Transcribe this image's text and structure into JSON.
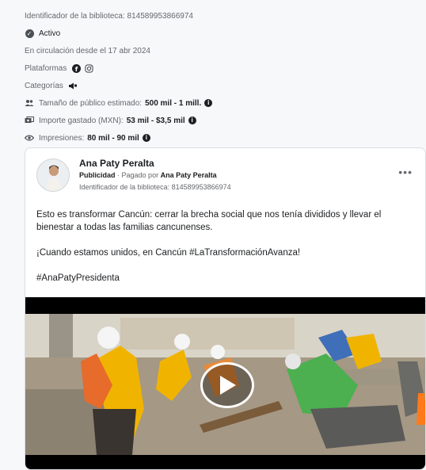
{
  "meta": {
    "library_id": "Identificador de la biblioteca: 814589953866974",
    "status": "Activo",
    "running_since": "En circulación desde el 17 abr 2024",
    "platforms_label": "Plataformas",
    "categories_label": "Categorías",
    "audience_label": "Tamaño de público estimado:",
    "audience_value": "500 mil - 1 mill.",
    "spent_label": "Importe gastado (MXN):",
    "spent_value": "53 mil - $3,5 mil",
    "impressions_label": "Impresiones:",
    "impressions_value": "80 mil - 90 mil"
  },
  "ad": {
    "page_name": "Ana Paty Peralta",
    "sponsored": "Publicidad",
    "paid_by_prefix": "· Pagado por",
    "paid_by": "Ana Paty Peralta",
    "library_id": "Identificador de la biblioteca: 814589953866974",
    "more": "•••",
    "text_1": "Esto es transformar Cancún: cerrar la brecha social que nos tenía divididos y llevar el bienestar a todas las familias cancunenses.",
    "text_2": "¡Cuando estamos unidos, en Cancún #LaTransformaciónAvanza!",
    "text_3": "#AnaPatyPresidenta"
  },
  "icons": {
    "status": "check-circle-icon",
    "platform_1": "facebook-icon",
    "platform_2": "instagram-icon",
    "category": "megaphone-icon",
    "audience": "people-icon",
    "spent": "money-icon",
    "impressions": "eye-icon",
    "play": "play-icon"
  },
  "colors": {
    "accent_dark": "#1c1e21",
    "muted": "#65676b",
    "card_bg": "#ffffff",
    "page_bg": "#f7f8fa"
  }
}
